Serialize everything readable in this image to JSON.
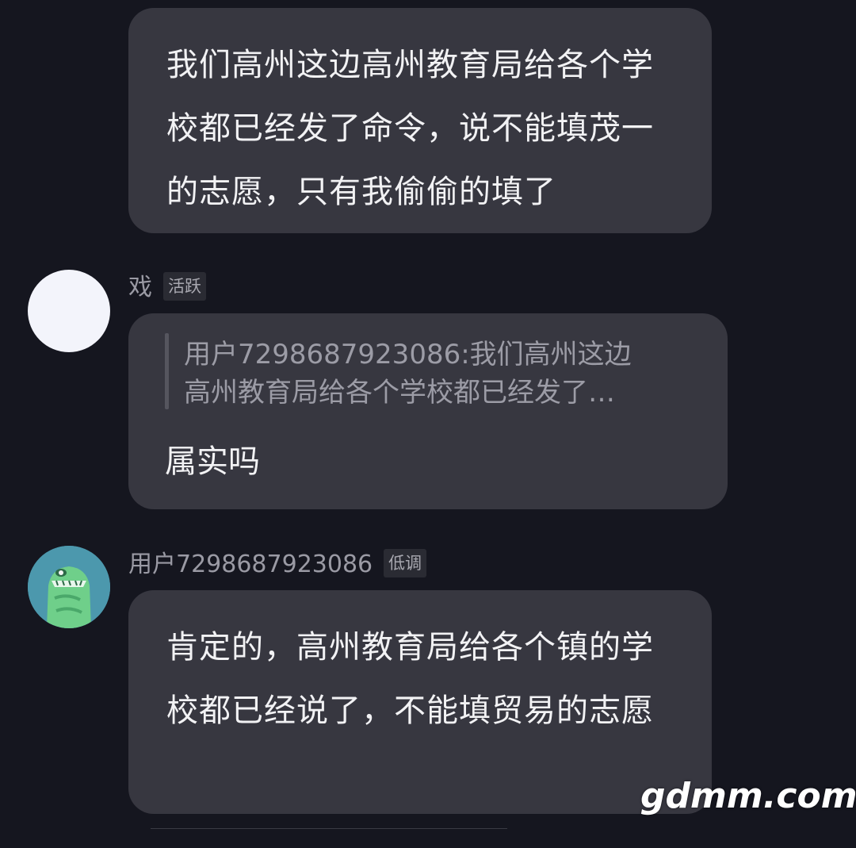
{
  "messages": [
    {
      "text": "我们高州这边高州教育局给各个学校都已经发了命令，说不能填茂一的志愿，只有我偷偷的填了"
    },
    {
      "username": "戏",
      "badge": "活跃",
      "quote_line1": "用户7298687923086:我们高州这边",
      "quote_line2": "高州教育局给各个学校都已经发了…",
      "text": "属实吗"
    },
    {
      "username": "用户7298687923086",
      "badge": "低调",
      "text": "肯定的，高州教育局给各个镇的学校都已经说了，不能填贸易的志愿"
    }
  ],
  "watermark": "gdmm.com",
  "colors": {
    "background": "#15161f",
    "bubble": "#373740",
    "avatar_user_bg": "#4c98ad",
    "avatar_xi_bg": "#f3f4fb"
  },
  "icons": {
    "avatar_user": "green-monster-avatar"
  }
}
